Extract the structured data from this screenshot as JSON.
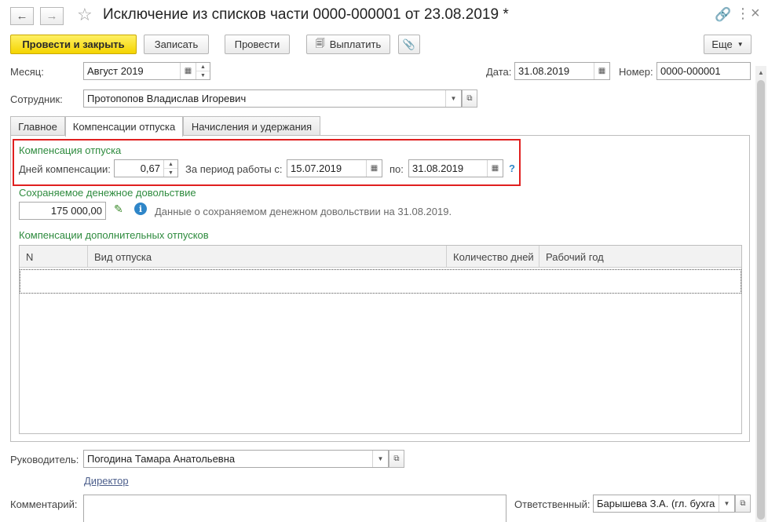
{
  "window": {
    "title": "Исключение из списков части 0000-000001 от 23.08.2019 *"
  },
  "toolbar": {
    "post_and_close": "Провести и закрыть",
    "save": "Записать",
    "post": "Провести",
    "pay": "Выплатить",
    "more": "Еще"
  },
  "header": {
    "month_label": "Месяц:",
    "month_value": "Август 2019",
    "date_label": "Дата:",
    "date_value": "31.08.2019",
    "number_label": "Номер:",
    "number_value": "0000-000001",
    "employee_label": "Сотрудник:",
    "employee_value": "Протопопов Владислав Игоревич"
  },
  "tabs": [
    {
      "label": "Главное",
      "active": false
    },
    {
      "label": "Компенсации отпуска",
      "active": true
    },
    {
      "label": "Начисления и удержания",
      "active": false
    }
  ],
  "compensation": {
    "group_title": "Компенсация отпуска",
    "days_label": "Дней компенсации:",
    "days_value": "0,67",
    "period_from_label": "За период работы с:",
    "period_from_value": "15.07.2019",
    "period_to_label": "по:",
    "period_to_value": "31.08.2019",
    "help": "?"
  },
  "allowance": {
    "group_title": "Сохраняемое денежное довольствие",
    "amount": "175 000,00",
    "info": "Данные о сохраняемом денежном довольствии на 31.08.2019."
  },
  "extra_leave": {
    "group_title": "Компенсации дополнительных отпусков",
    "columns": [
      "N",
      "Вид отпуска",
      "Количество дней",
      "Рабочий год"
    ],
    "rows": []
  },
  "footer": {
    "manager_label": "Руководитель:",
    "manager_value": "Погодина Тамара Анатольевна",
    "manager_position": "Директор",
    "comment_label": "Комментарий:",
    "comment_value": "",
    "responsible_label": "Ответственный:",
    "responsible_value": "Барышева З.А. (гл. бухга"
  },
  "icons": {
    "back": "arrow-left-icon",
    "forward": "arrow-right-icon",
    "favorite": "star-icon",
    "link": "link-icon",
    "menu": "more-dots-icon",
    "close": "close-icon",
    "calendar": "calendar-icon",
    "dropdown": "chevron-down-icon",
    "open": "open-form-icon",
    "attach": "paperclip-icon",
    "edit": "pencil-icon",
    "info": "info-icon"
  },
  "colors": {
    "primary_button": "#f4d400",
    "group_title": "#2e8b3e",
    "highlight": "#e02020",
    "link": "#4d5f8c",
    "info": "#2f86c8"
  }
}
